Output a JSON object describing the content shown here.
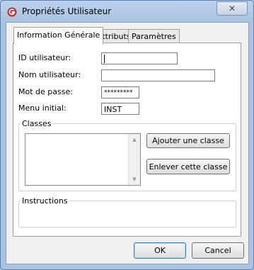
{
  "window": {
    "title": "Propriétés Utilisateur",
    "close_glyph": "✕"
  },
  "tabs": [
    {
      "label": "Information Générale",
      "active": true
    },
    {
      "label": "Attributs",
      "active": false
    },
    {
      "label": "Paramètres",
      "active": false
    }
  ],
  "form": {
    "user_id_label": "ID utilisateur:",
    "user_id_value": "",
    "user_name_label": "Nom utilisateur:",
    "user_name_value": "",
    "password_label": "Mot de passe:",
    "password_value": "*********",
    "initial_menu_label": "Menu initial:",
    "initial_menu_value": "INST"
  },
  "classes": {
    "group_title": "Classes",
    "add_button": "Ajouter une classe",
    "remove_button": "Enlever cette classe"
  },
  "instructions": {
    "group_title": "Instructions"
  },
  "footer": {
    "ok_label": "OK",
    "cancel_label": "Cancel"
  },
  "icons": {
    "app": "app-logo-icon",
    "close": "close-icon",
    "scroll_up": "scroll-up-icon",
    "scroll_down": "scroll-down-icon"
  }
}
